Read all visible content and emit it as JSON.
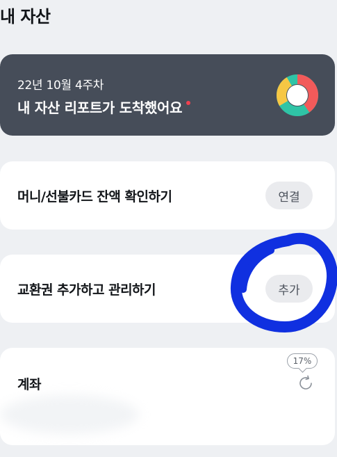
{
  "header": {
    "title": "내 자산"
  },
  "report": {
    "date": "22년 10월 4주차",
    "title": "내 자산 리포트가 도착했어요",
    "donut_colors": [
      "#f25a5a",
      "#2fc4a6",
      "#f6c744",
      "#ffffff"
    ]
  },
  "money_card": {
    "label": "머니/선불카드 잔액 확인하기",
    "button_label": "연결"
  },
  "voucher_card": {
    "label": "교환권 추가하고 관리하기",
    "button_label": "추가"
  },
  "account_card": {
    "label": "계좌",
    "progress": "17%"
  },
  "colors": {
    "background": "#eef0f3",
    "report_bg": "#464d59",
    "new_dot": "#f0404f",
    "annotation": "#1030e0"
  },
  "icons": {
    "report": "donut-chart-icon",
    "account": "refresh-icon"
  }
}
